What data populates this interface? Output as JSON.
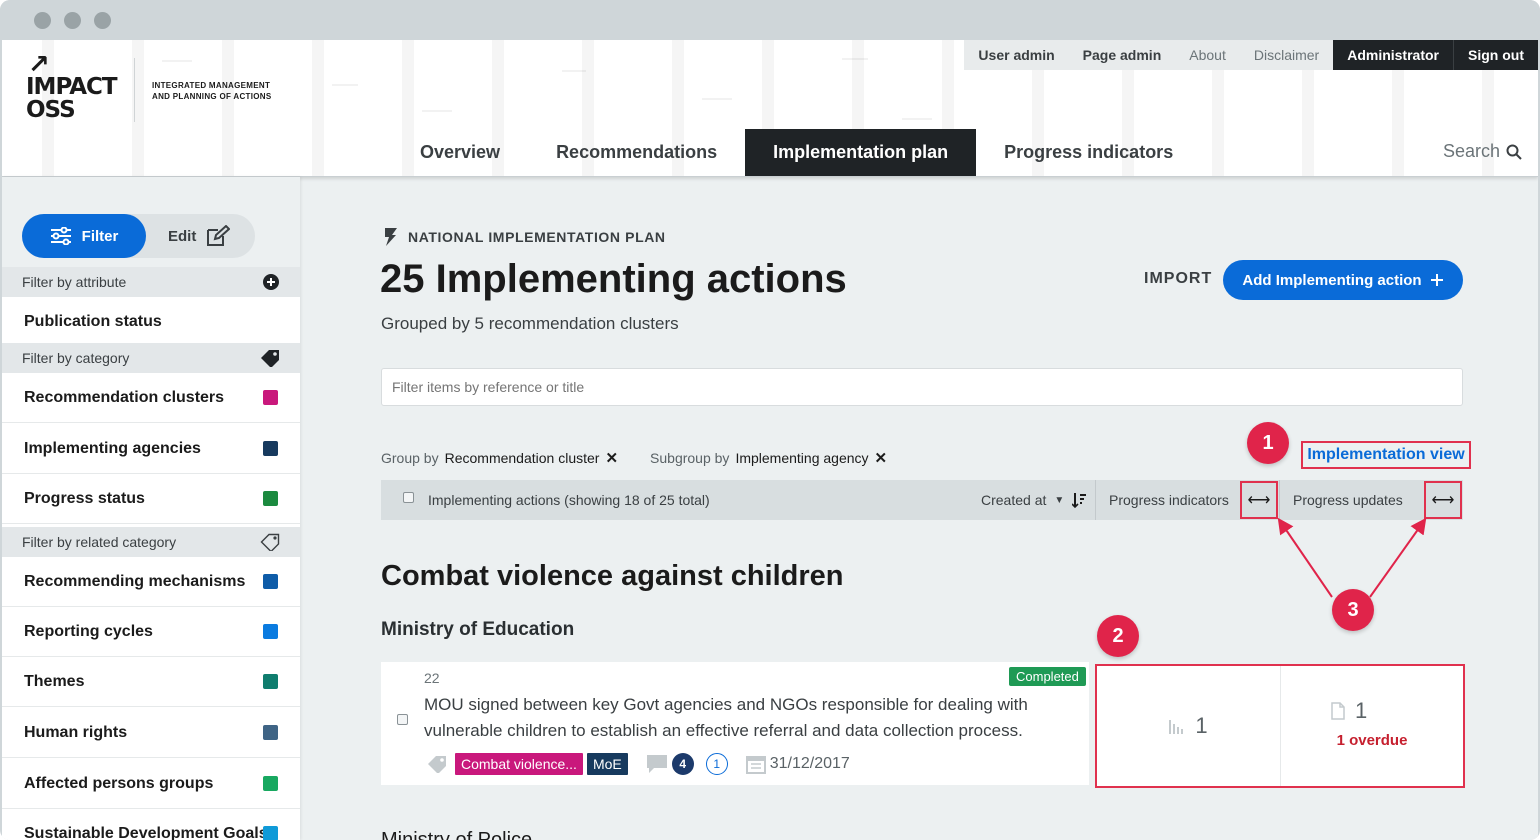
{
  "window": {
    "controls": [
      "close",
      "minimize",
      "maximize"
    ]
  },
  "brand": {
    "logo_line1": "IMPACT",
    "logo_line2": "OSS",
    "claim": "INTEGRATED MANAGEMENT AND PLANNING OF ACTIONS"
  },
  "topnav": {
    "user_admin": "User admin",
    "page_admin": "Page admin",
    "about": "About",
    "disclaimer": "Disclaimer",
    "administrator": "Administrator",
    "sign_out": "Sign out"
  },
  "mainnav": {
    "overview": "Overview",
    "recommendations": "Recommendations",
    "implementation_plan": "Implementation plan",
    "progress_indicators": "Progress indicators",
    "search": "Search"
  },
  "sidebar": {
    "filter_label": "Filter",
    "edit_label": "Edit",
    "sections": {
      "by_attribute": "Filter by attribute",
      "by_category": "Filter by category",
      "by_related": "Filter by related category"
    },
    "attribute_items": [
      {
        "label": "Publication status"
      }
    ],
    "category_items": [
      {
        "label": "Recommendation clusters",
        "color": "#c9187c"
      },
      {
        "label": "Implementing agencies",
        "color": "#173a5e"
      },
      {
        "label": "Progress status",
        "color": "#1b8a3f"
      }
    ],
    "related_items": [
      {
        "label": "Recommending mechanisms",
        "color": "#0e5ca8"
      },
      {
        "label": "Reporting cycles",
        "color": "#0a7be0"
      },
      {
        "label": "Themes",
        "color": "#0f7d6e"
      },
      {
        "label": "Human rights",
        "color": "#3f6485"
      },
      {
        "label": "Affected persons groups",
        "color": "#18a860"
      },
      {
        "label": "Sustainable Development Goals",
        "color": "#0f9ad8"
      }
    ]
  },
  "main": {
    "eyebrow": "NATIONAL IMPLEMENTATION PLAN",
    "title": "25 Implementing actions",
    "subtitle": "Grouped by 5 recommendation clusters",
    "import_label": "IMPORT",
    "add_label": "Add Implementing action",
    "filter_placeholder": "Filter items by reference or title",
    "group_by_label": "Group by",
    "group_by_value": "Recommendation cluster",
    "subgroup_by_label": "Subgroup by",
    "subgroup_by_value": "Implementing agency",
    "implementation_view": "Implementation view",
    "list_header": {
      "label": "Implementing actions (showing 18 of 25 total)",
      "sort_label": "Created at",
      "col_progress_indicators": "Progress indicators",
      "col_progress_updates": "Progress updates"
    },
    "group_title": "Combat violence against children",
    "subgroup_title": "Ministry of Education",
    "item": {
      "ref": "22",
      "status": "Completed",
      "title": "MOU signed between key Govt agencies and NGOs responsible for dealing with vulnerable children to establish an effective referral and data collection process.",
      "tag_cluster": "Combat violence...",
      "tag_cluster_color": "#c9187c",
      "tag_agency": "MoE",
      "tag_agency_color": "#173a5e",
      "count_dark": "4",
      "count_outline": "1",
      "date": "31/12/2017",
      "progress_indicators_count": "1",
      "progress_updates_count": "1",
      "overdue": "1 overdue"
    },
    "next_group_partial": "Ministry of Police"
  },
  "annotations": {
    "one": "1",
    "two": "2",
    "three": "3"
  },
  "colors": {
    "accent": "#0a6bd8",
    "annotation": "#e0244a",
    "dark": "#1f2326"
  }
}
